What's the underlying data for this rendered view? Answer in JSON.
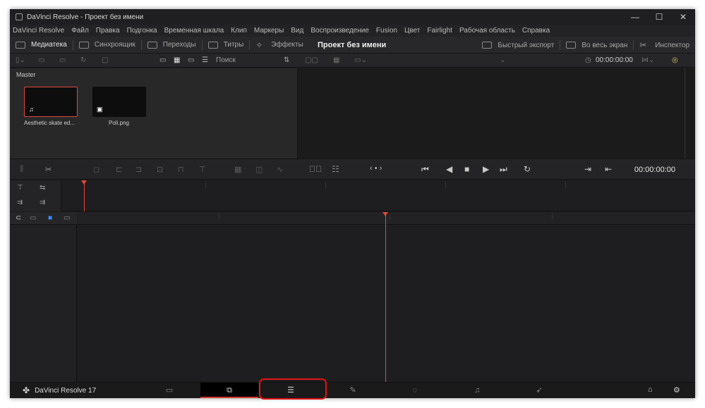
{
  "window": {
    "title": "DaVinci Resolve - Проект без имени",
    "controls": [
      "—",
      "☐",
      "✕"
    ]
  },
  "menu": [
    "DaVinci Resolve",
    "Файл",
    "Правка",
    "Подгонка",
    "Временная шкала",
    "Клип",
    "Маркеры",
    "Вид",
    "Воспроизведение",
    "Fusion",
    "Цвет",
    "Fairlight",
    "Рабочая область",
    "Справка"
  ],
  "toolbar": {
    "media_pool": "Медиатека",
    "sync": "Синхроящик",
    "transitions": "Переходы",
    "titles": "Титры",
    "effects": "Эффекты",
    "project_title": "Проект без имени",
    "quick_export": "Быстрый экспорт",
    "fullscreen": "Во весь экран",
    "inspector": "Инспектор"
  },
  "media": {
    "search_label": "Поиск",
    "bin_name": "Master",
    "clips": [
      {
        "label": "Aesthetic skate ed...",
        "icon": "music-note-icon",
        "glyph": "♫"
      },
      {
        "label": "Poli.png",
        "icon": "image-icon",
        "glyph": "▣"
      }
    ]
  },
  "viewer": {
    "timecode_top": "00:00:00:00",
    "timecode": "00:00:00:00"
  },
  "bottom": {
    "app_name": "DaVinci Resolve 17",
    "pages": [
      {
        "name": "media",
        "glyph": "▭"
      },
      {
        "name": "cut",
        "glyph": "⧉"
      },
      {
        "name": "edit",
        "glyph": "☰"
      },
      {
        "name": "fusion",
        "glyph": "✎"
      },
      {
        "name": "color",
        "glyph": "◌"
      },
      {
        "name": "fairlight",
        "glyph": "♫"
      },
      {
        "name": "deliver",
        "glyph": "➶"
      }
    ],
    "home_glyph": "⌂",
    "settings_glyph": "⚙"
  },
  "colors": {
    "accent": "#e0483a",
    "highlight": "#e11212",
    "panel": "#28282a"
  }
}
